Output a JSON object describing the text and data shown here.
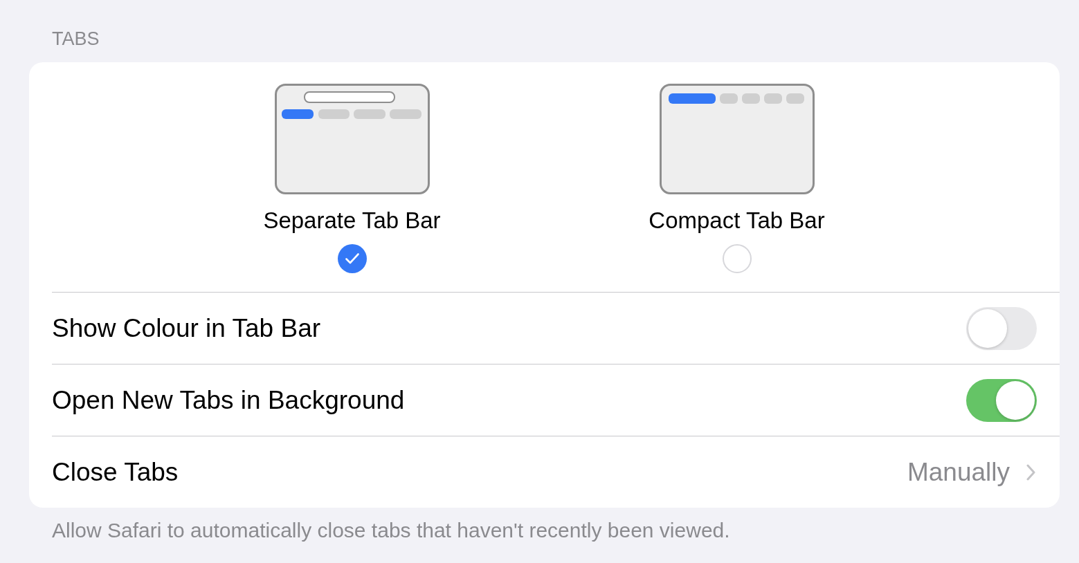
{
  "section_header": "TABS",
  "tab_layouts": [
    {
      "kind": "separate",
      "label": "Separate Tab Bar",
      "selected": true
    },
    {
      "kind": "compact",
      "label": "Compact Tab Bar",
      "selected": false
    }
  ],
  "rows": [
    {
      "kind": "toggle",
      "label": "Show Colour in Tab Bar",
      "on": false
    },
    {
      "kind": "toggle",
      "label": "Open New Tabs in Background",
      "on": true
    },
    {
      "kind": "link",
      "label": "Close Tabs",
      "value": "Manually"
    }
  ],
  "footer": "Allow Safari to automatically close tabs that haven't recently been viewed."
}
